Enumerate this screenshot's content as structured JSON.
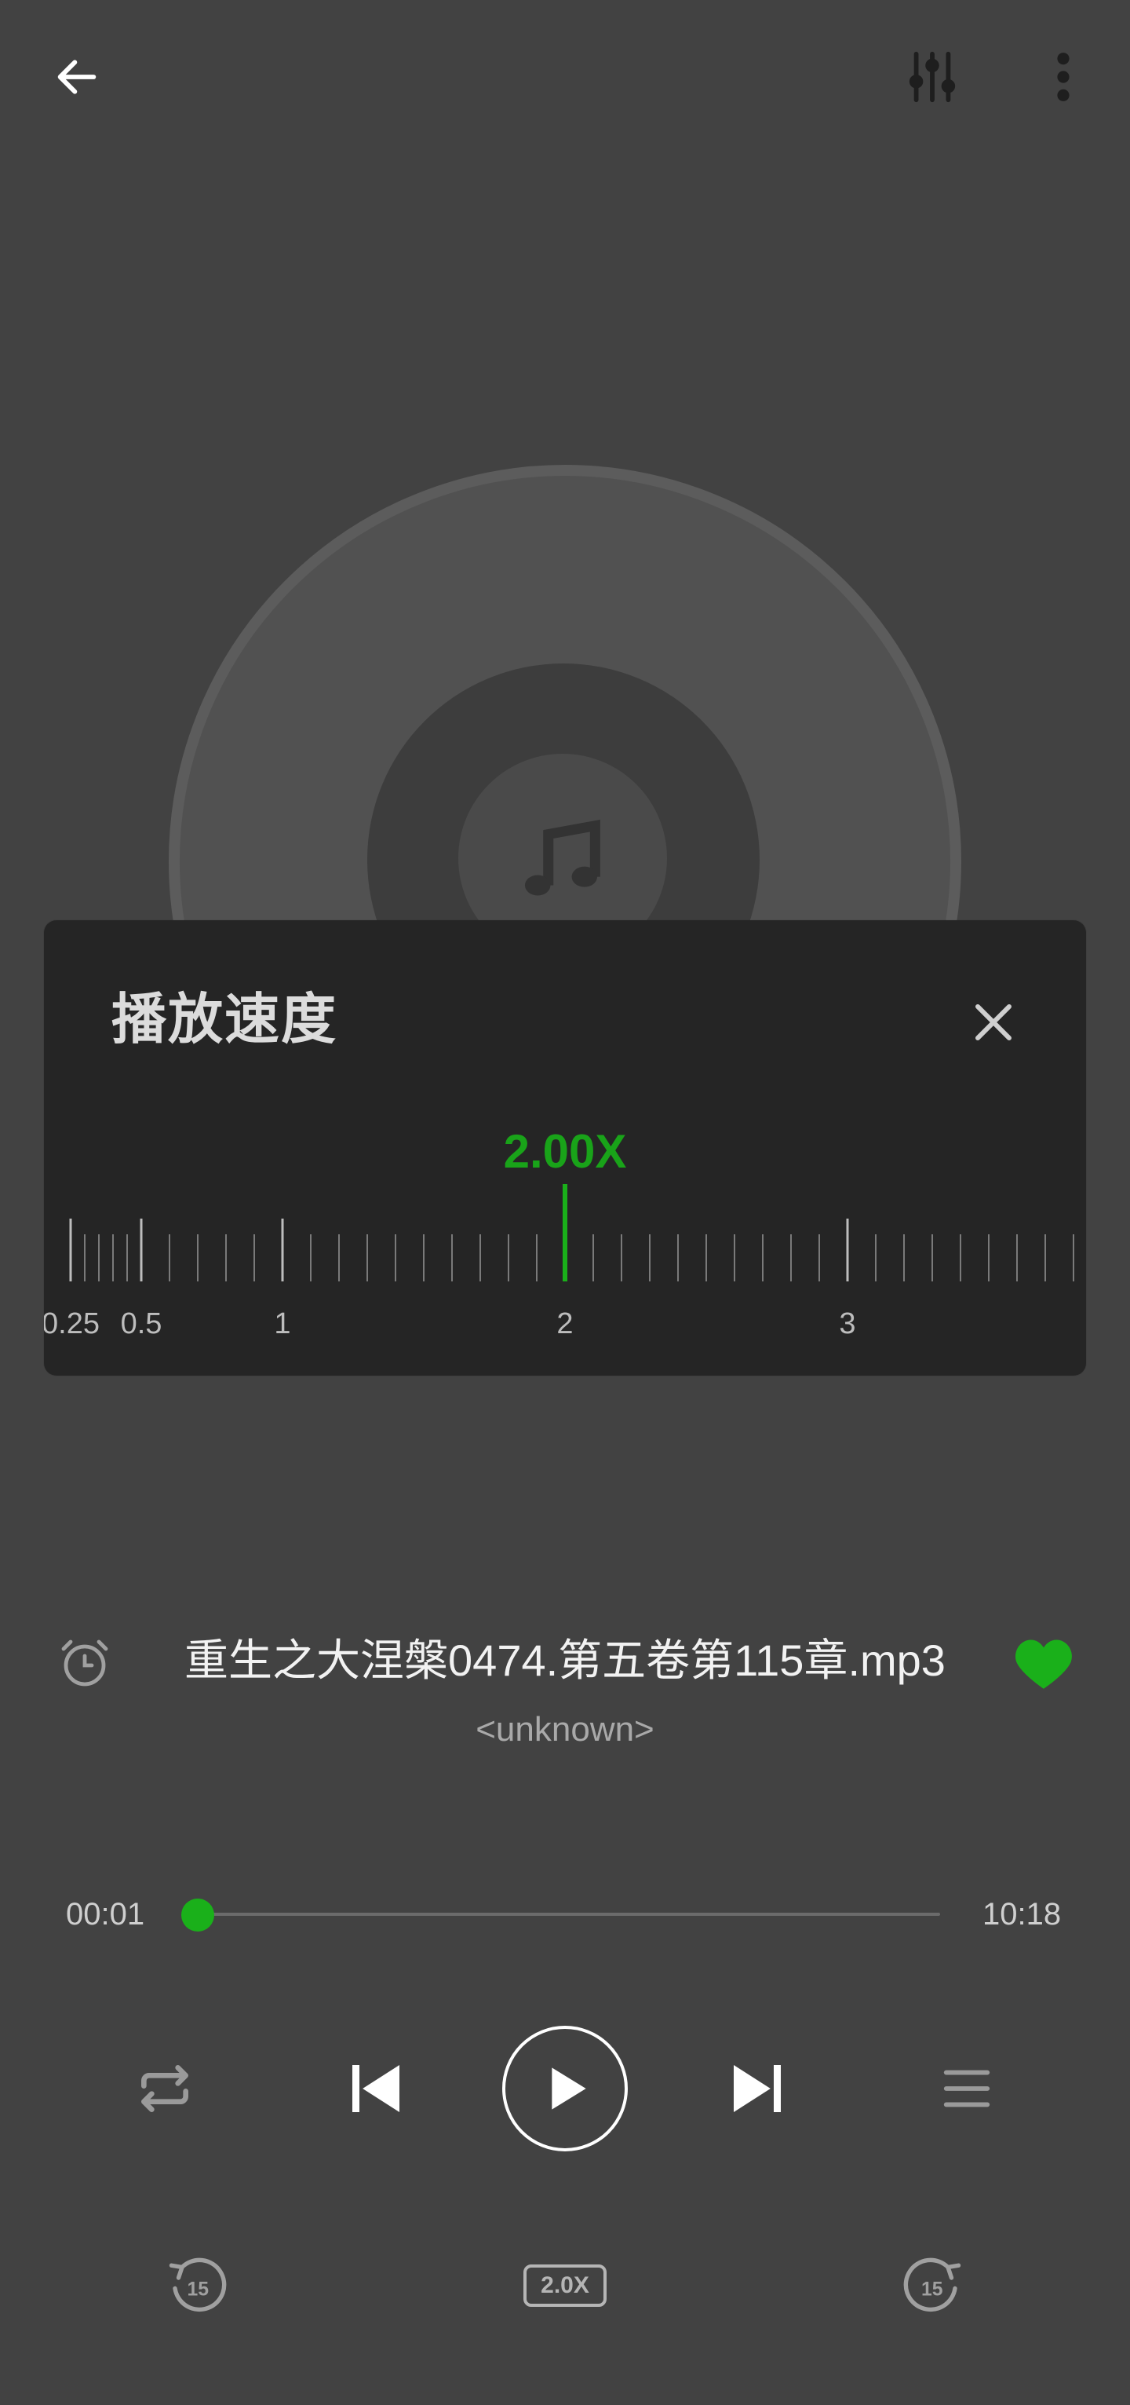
{
  "icons": {
    "back": "arrow-left-icon",
    "equalizer": "equalizer-icon",
    "more": "more-vertical-icon",
    "music_note": "music-note-icon",
    "close": "close-icon",
    "alarm": "alarm-clock-icon",
    "favorite": "heart-icon",
    "repeat": "repeat-icon",
    "previous": "skip-previous-icon",
    "play": "play-icon",
    "next": "skip-next-icon",
    "playlist": "playlist-icon",
    "rewind": "rewind-15-icon",
    "forward": "forward-15-icon"
  },
  "speed_panel": {
    "title": "播放速度",
    "current_value": "2.00X",
    "current_speed": 2.0,
    "ruler_labels": [
      "0.25",
      "0.5",
      "1",
      "2",
      "3"
    ],
    "ruler_min": 0.25,
    "ruler_major_step": 1
  },
  "song": {
    "title": "重生之大涅槃0474.第五卷第115章.mp3",
    "artist": "<unknown>",
    "favorited": true
  },
  "progress": {
    "current": "00:01",
    "total": "10:18",
    "fraction": 0.0016
  },
  "bottom": {
    "rewind_seconds": "15",
    "speed_label": "2.0X",
    "forward_seconds": "15"
  },
  "colors": {
    "accent": "#1ab01a",
    "background": "#424242",
    "panel": "#252525"
  }
}
